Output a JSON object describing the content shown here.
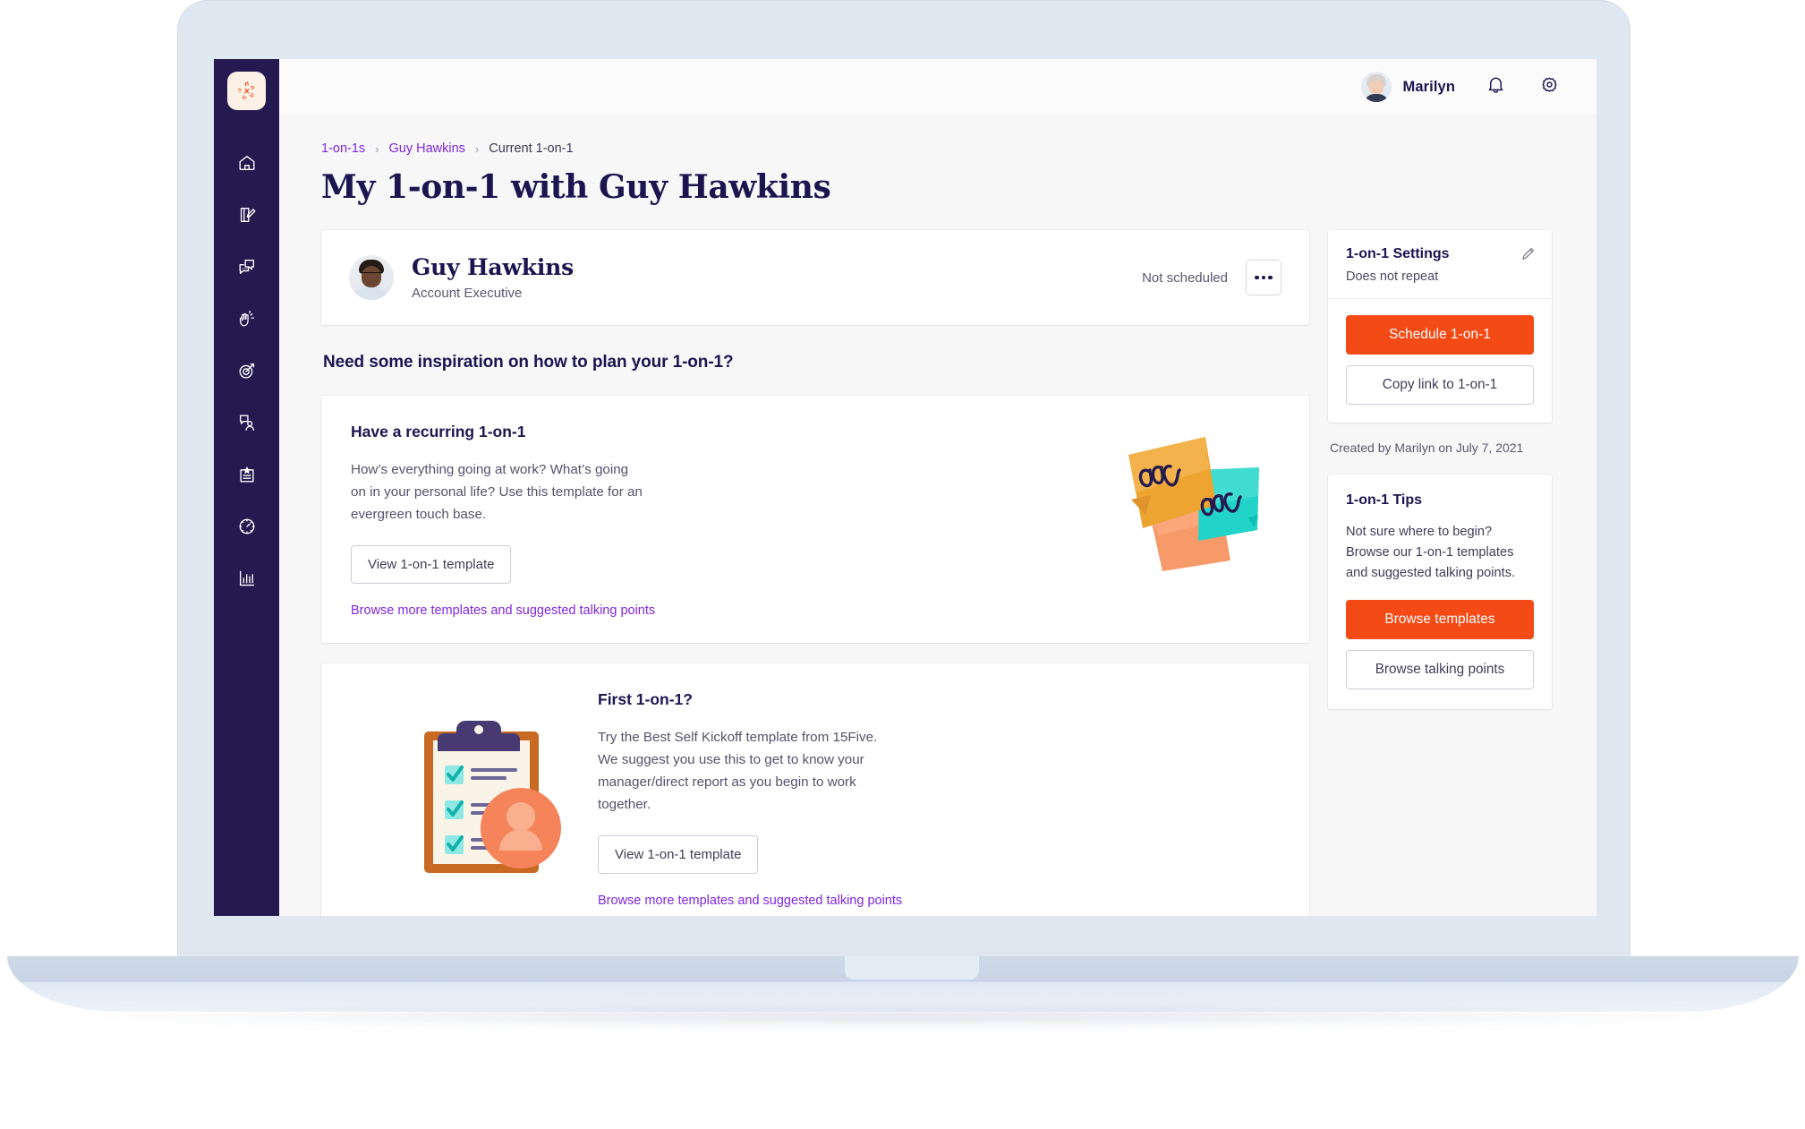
{
  "brand": {
    "logo_name": "15five-logo",
    "accent_orange": "#f44a16",
    "nav_bg": "#241a4f",
    "link_purple": "#8126e0",
    "ink": "#1c1550"
  },
  "sidebar": {
    "items": [
      {
        "icon": "home-icon",
        "label": "Home"
      },
      {
        "icon": "check-in-icon",
        "label": "Check-ins"
      },
      {
        "icon": "feedback-chat-icon",
        "label": "Feedback"
      },
      {
        "icon": "high-five-icon",
        "label": "High Fives"
      },
      {
        "icon": "objectives-target-icon",
        "label": "Objectives"
      },
      {
        "icon": "one-on-one-icon",
        "label": "1-on-1s"
      },
      {
        "icon": "reviews-clipboard-icon",
        "label": "Reviews"
      },
      {
        "icon": "engagement-gauge-icon",
        "label": "Engagement"
      },
      {
        "icon": "analytics-bar-icon",
        "label": "Analytics"
      }
    ]
  },
  "topbar": {
    "user_name": "Marilyn",
    "avatar_name": "user-avatar",
    "notifications_icon": "bell-icon",
    "settings_icon": "gear-icon"
  },
  "breadcrumb": {
    "items": [
      {
        "label": "1-on-1s",
        "current": false
      },
      {
        "label": "Guy Hawkins",
        "current": false
      },
      {
        "label": "Current 1-on-1",
        "current": true
      }
    ],
    "separator": "›"
  },
  "page": {
    "title": "My 1-on-1 with Guy Hawkins"
  },
  "profile": {
    "name": "Guy Hawkins",
    "role": "Account Executive",
    "schedule_status": "Not scheduled",
    "more_menu_label": "•••"
  },
  "inspiration": {
    "heading": "Need some inspiration on how to plan your 1-on-1?",
    "cards": [
      {
        "title": "Have a recurring 1-on-1",
        "text": "How’s everything going at work? What’s going on in your personal life? Use this template for an evergreen touch base.",
        "button": "View 1-on-1 template",
        "link": "Browse more templates and suggested talking points",
        "illustration": "sticky-notes-illustration"
      },
      {
        "title": "First 1-on-1?",
        "text": "Try the Best Self Kickoff template from 15Five. We suggest you use this to get to know your manager/direct report as you begin to work together.",
        "button": "View 1-on-1 template",
        "link": "Browse more templates and suggested talking points",
        "illustration": "clipboard-checklist-illustration"
      }
    ]
  },
  "settings_panel": {
    "title": "1-on-1 Settings",
    "repeat_status": "Does not repeat",
    "edit_icon": "pencil-icon",
    "schedule_button": "Schedule 1-on-1",
    "copy_link_button": "Copy link to 1-on-1",
    "created_by": "Created by Marilyn on July 7, 2021"
  },
  "tips_panel": {
    "title": "1-on-1 Tips",
    "text": "Not sure where to begin? Browse our 1-on-1 templates and suggested talking points.",
    "browse_templates_button": "Browse templates",
    "browse_talking_points_button": "Browse talking points"
  }
}
